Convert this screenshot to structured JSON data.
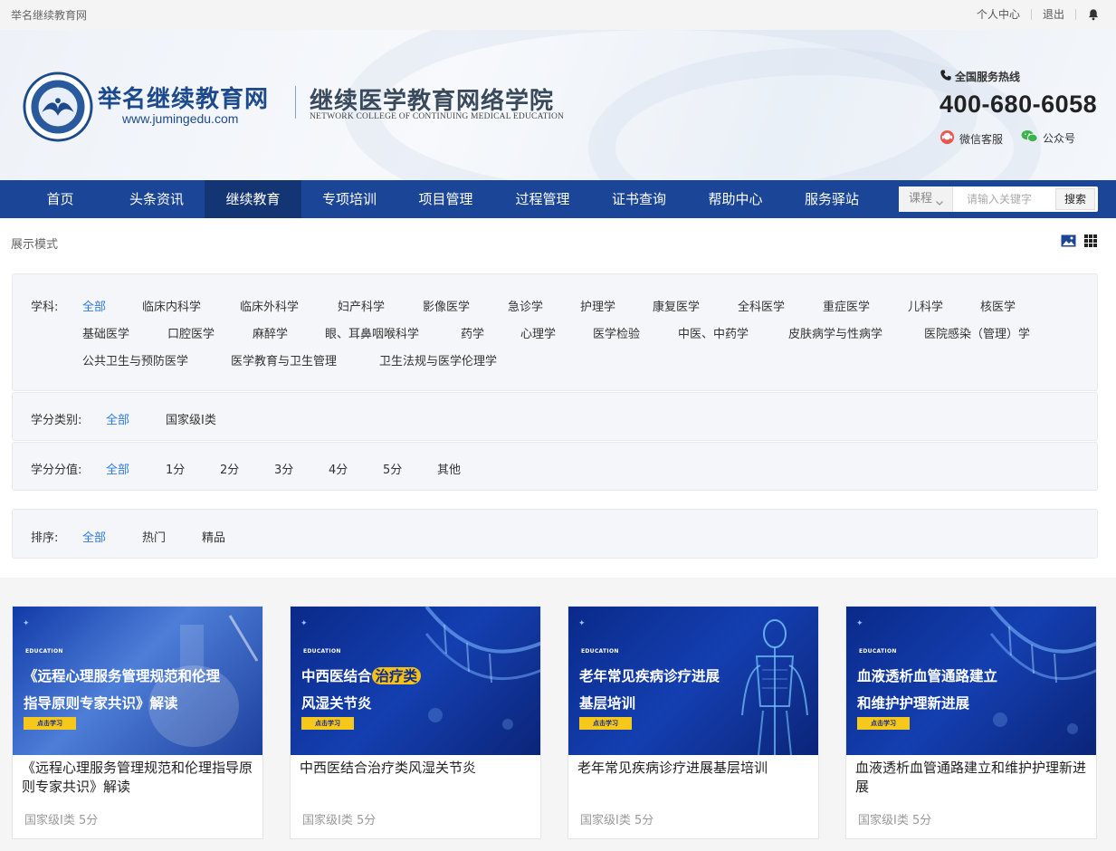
{
  "topbar": {
    "site_name": "举名继续教育网",
    "personal_center": "个人中心",
    "logout": "退出",
    "bell_icon": "bell-icon"
  },
  "header": {
    "brand_title": "举名继续教育网",
    "brand_url": "www.jumingedu.com",
    "college_title": "继续医学教育网络学院",
    "college_en": "NETWORK COLLEGE OF CONTINUING MEDICAL EDUCATION",
    "hotline_label": "全国服务热线",
    "hotline_number": "400-680-6058",
    "wechat_service": "微信客服",
    "official_account": "公众号"
  },
  "nav": {
    "items": [
      "首页",
      "头条资讯",
      "继续教育",
      "专项培训",
      "项目管理",
      "过程管理",
      "证书查询",
      "帮助中心",
      "服务驿站"
    ],
    "active": "继续教育",
    "search": {
      "type": "课程",
      "placeholder": "请输入关键字",
      "button": "搜索"
    }
  },
  "display_mode": {
    "label": "展示模式",
    "icons": [
      "image-view-icon",
      "grid-view-icon"
    ]
  },
  "filters": {
    "subject": {
      "label": "学科:",
      "options": [
        "全部",
        "临床内科学",
        "临床外科学",
        "妇产科学",
        "影像医学",
        "急诊学",
        "护理学",
        "康复医学",
        "全科医学",
        "重症医学",
        "儿科学",
        "核医学",
        "基础医学",
        "口腔医学",
        "麻醉学",
        "眼、耳鼻咽喉科学",
        "药学",
        "心理学",
        "医学检验",
        "中医、中药学",
        "皮肤病学与性病学",
        "医院感染（管理）学",
        "公共卫生与预防医学",
        "医学教育与卫生管理",
        "卫生法规与医学伦理学"
      ],
      "selected": "全部"
    },
    "credit_type": {
      "label": "学分类别:",
      "options": [
        "全部",
        "国家级I类"
      ],
      "selected": "全部"
    },
    "credit_value": {
      "label": "学分分值:",
      "options": [
        "全部",
        "1分",
        "2分",
        "3分",
        "4分",
        "5分",
        "其他"
      ],
      "selected": "全部"
    },
    "sort": {
      "label": "排序:",
      "options": [
        "全部",
        "热门",
        "精品"
      ],
      "selected": "全部"
    }
  },
  "courses": [
    {
      "thumb_edu": "EDUCATION",
      "thumb_title_line1": "《远程心理服务管理规范和伦理",
      "thumb_title_line2": "指导原则专家共识》解读",
      "thumb_button": "点击学习",
      "title": "《远程心理服务管理规范和伦理指导原则专家共识》解读",
      "meta": "国家级I类 5分"
    },
    {
      "thumb_edu": "EDUCATION",
      "thumb_title_line1": "中西医结合",
      "thumb_title_highlight": "治疗类",
      "thumb_title_line2": "风湿关节炎",
      "thumb_button": "点击学习",
      "title": "中西医结合治疗类风湿关节炎",
      "meta": "国家级I类 5分"
    },
    {
      "thumb_edu": "EDUCATION",
      "thumb_title_line1": "老年常见疾病诊疗进展",
      "thumb_title_line2": "基层培训",
      "thumb_button": "点击学习",
      "title": "老年常见疾病诊疗进展基层培训",
      "meta": "国家级I类 5分"
    },
    {
      "thumb_edu": "EDUCATION",
      "thumb_title_line1": "血液透析血管通路建立",
      "thumb_title_line2": "和维护护理新进展",
      "thumb_button": "点击学习",
      "title": "血液透析血管通路建立和维护护理新进展",
      "meta": "国家级I类 5分"
    }
  ],
  "colors": {
    "nav_bg": "#1b4596",
    "nav_active": "#133574",
    "accent_blue": "#2f7ae0",
    "brand_blue": "#1d4a8c"
  }
}
